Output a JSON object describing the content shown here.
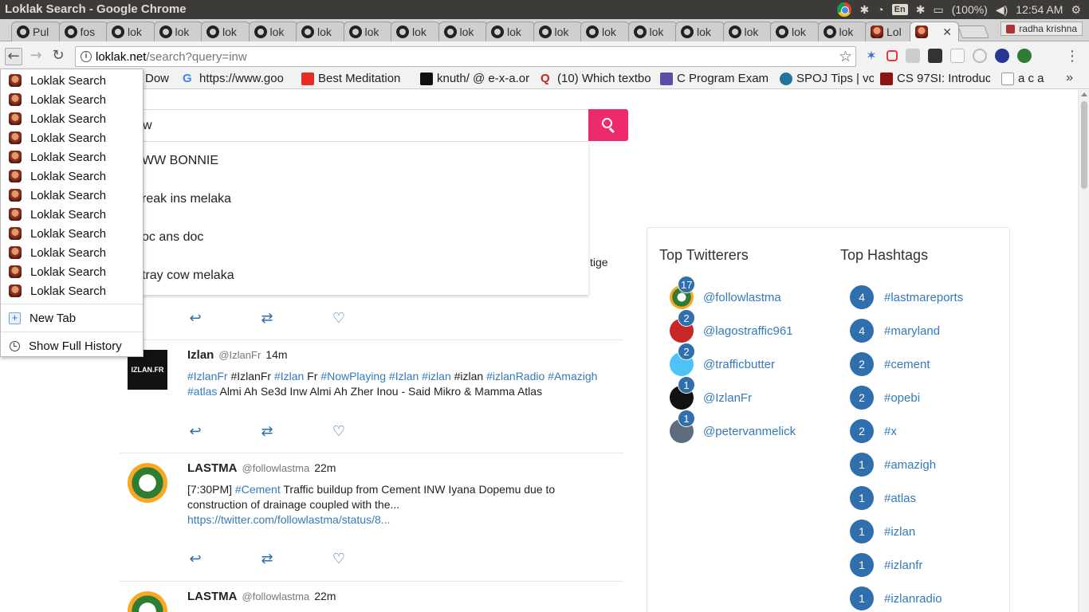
{
  "os_panel": {
    "window_title": "Loklak Search - Google Chrome",
    "lang": "En",
    "battery": "(100%)",
    "clock": "12:54 AM"
  },
  "tabs": {
    "github_labels": [
      "Pul",
      "fos",
      "lok",
      "lok",
      "lok",
      "lok",
      "lok",
      "lok",
      "lok",
      "lok",
      "lok",
      "lok",
      "lok",
      "lok",
      "lok",
      "lok",
      "lok",
      "lok"
    ],
    "loklak_tab_label": "Lol",
    "profile_name": "radha krishna"
  },
  "omnibox": {
    "host": "loklak.net",
    "path": "/search?query=inw"
  },
  "bookmarks": [
    {
      "label": "Dow",
      "icon_color": "#555"
    },
    {
      "label": "https://www.goo",
      "icon_color": "#4285f4"
    },
    {
      "label": "Best Meditation",
      "icon_color": "#e52d27"
    },
    {
      "label": "knuth/ @ e-x-a.or",
      "icon_color": "#111"
    },
    {
      "label": "(10) Which textbo",
      "icon_color": "#b92b27"
    },
    {
      "label": "C Program Exam",
      "icon_color": "#5a4fa2"
    },
    {
      "label": "SPOJ Tips | vc",
      "icon_color": "#21759b"
    },
    {
      "label": "CS 97SI: Introduc",
      "icon_color": "#8c1515"
    },
    {
      "label": "a c a",
      "icon_color": "#999"
    }
  ],
  "search": {
    "query": "w",
    "suggestions": [
      "WW BONNIE",
      "reak ins melaka",
      "oc ans doc",
      "tray cow melaka"
    ]
  },
  "history_menu": {
    "items": [
      "Loklak Search",
      "Loklak Search",
      "Loklak Search",
      "Loklak Search",
      "Loklak Search",
      "Loklak Search",
      "Loklak Search",
      "Loklak Search",
      "Loklak Search",
      "Loklak Search",
      "Loklak Search",
      "Loklak Search"
    ],
    "new_tab": "New Tab",
    "show_full_history": "Show Full History"
  },
  "tweets": {
    "partial_text": "tige",
    "izlan": {
      "name": "Izlan",
      "handle": "@IzlanFr",
      "time": "14m",
      "avatar_text": "IZLAN.FR",
      "t1": "#IzlanFr",
      "t2": " #IzlanFr ",
      "t3": "#Izlan",
      "t4": " Fr ",
      "t5": "#NowPlaying",
      "t6": " ",
      "t7": "#Izlan",
      "t8": " ",
      "t9": "#izlan",
      "t10": " #izlan ",
      "t11": "#izlanRadio",
      "t12": " ",
      "t13": "#Amazigh",
      "t14": "#atlas",
      "t15": " Almi Ah Se3d Inw Almi Ah Zher Inou - Said Mikro & Mamma Atlas"
    },
    "lastma1": {
      "name": "LASTMA",
      "handle": "@followlastma",
      "time": "22m",
      "prefix": "[7:30PM] ",
      "hashtag": "#Cement",
      "body": " Traffic buildup from Cement INW Iyana Dopemu due to construction of drainage coupled with the...",
      "link": "https://twitter.com/followlastma/status/8..."
    },
    "lastma2": {
      "name": "LASTMA",
      "handle": "@followlastma",
      "time": "22m"
    }
  },
  "top_twitterers": {
    "heading": "Top Twitterers",
    "items": [
      {
        "name": "@followlastma",
        "count": "17"
      },
      {
        "name": "@lagostraffic961",
        "count": "2"
      },
      {
        "name": "@trafficbutter",
        "count": "2"
      },
      {
        "name": "@IzlanFr",
        "count": "1"
      },
      {
        "name": "@petervanmelick",
        "count": "1"
      }
    ]
  },
  "top_hashtags": {
    "heading": "Top Hashtags",
    "items": [
      {
        "name": "#lastmareports",
        "count": "4"
      },
      {
        "name": "#maryland",
        "count": "4"
      },
      {
        "name": "#cement",
        "count": "2"
      },
      {
        "name": "#opebi",
        "count": "2"
      },
      {
        "name": "#x",
        "count": "2"
      },
      {
        "name": "#amazigh",
        "count": "1"
      },
      {
        "name": "#atlas",
        "count": "1"
      },
      {
        "name": "#izlan",
        "count": "1"
      },
      {
        "name": "#izlanfr",
        "count": "1"
      },
      {
        "name": "#izlanradio",
        "count": "1"
      }
    ]
  },
  "colors": {
    "accent_pink": "#ed2a6e",
    "badge_blue": "#2f6fad",
    "link_blue": "#337ab7"
  }
}
